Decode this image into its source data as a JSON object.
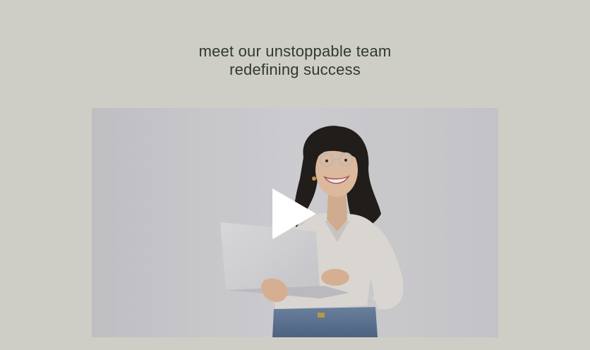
{
  "section": {
    "heading_line1": "meet our unstoppable team",
    "heading_line2": "redefining success"
  },
  "video": {
    "icon": "play-icon",
    "overlay_color": "#3c3a37"
  },
  "colors": {
    "page_background": "#cfcec6",
    "heading_text": "#2f3a33",
    "video_backdrop": "#d9d8dc",
    "play_button": "#ffffff"
  }
}
